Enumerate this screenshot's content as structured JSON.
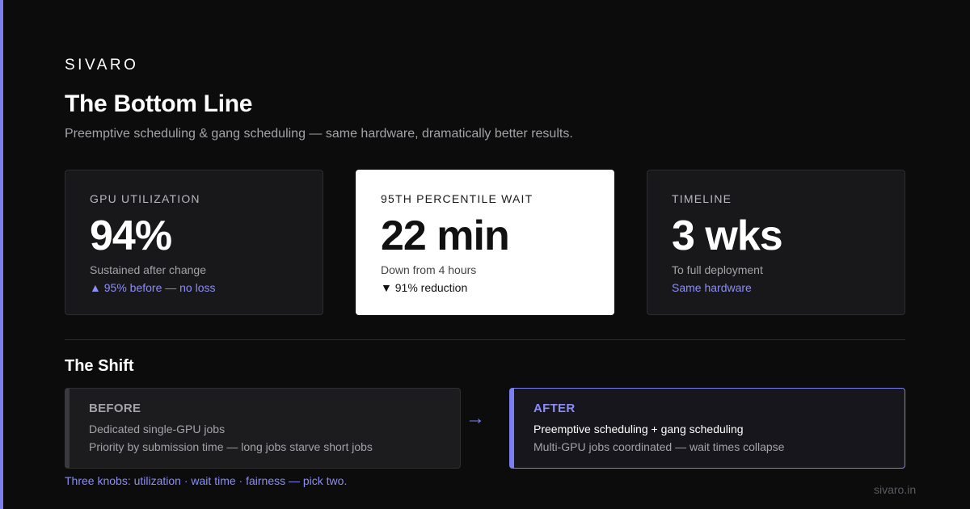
{
  "brand": "SIVARO",
  "title": "The Bottom Line",
  "subtitle": "Preemptive scheduling & gang scheduling — same hardware, dramatically better results.",
  "colors": {
    "background": "#0c0c0d",
    "accent": "#7b7ff0",
    "highlight_card": "#ffffff"
  },
  "metrics": [
    {
      "label": "GPU UTILIZATION",
      "value": "94%",
      "description": "Sustained after change",
      "note": "▲ 95% before — no loss"
    },
    {
      "label": "95TH PERCENTILE WAIT",
      "value": "22 min",
      "description": "Down from 4 hours",
      "note": "▼ 91% reduction"
    },
    {
      "label": "TIMELINE",
      "value": "3 wks",
      "description": "To full deployment",
      "note": "Same hardware"
    }
  ],
  "shift": {
    "title": "The Shift",
    "arrow": "→",
    "before": {
      "label": "BEFORE",
      "lines": [
        "Dedicated single-GPU jobs",
        "Priority by submission time — long jobs starve short jobs"
      ]
    },
    "after": {
      "label": "AFTER",
      "lines": [
        "Preemptive scheduling + gang scheduling",
        "Multi-GPU jobs coordinated — wait times collapse"
      ]
    }
  },
  "footnote": "Three knobs: utilization · wait time · fairness — pick two.",
  "site": "sivaro.in"
}
